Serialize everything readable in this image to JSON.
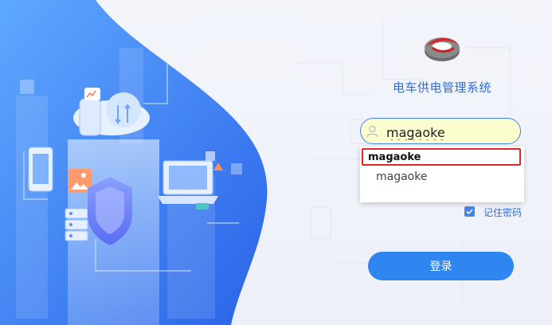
{
  "app": {
    "title": "电车供电管理系统",
    "logo_icon": "train-logo-icon"
  },
  "login_form": {
    "username_value": "magaoke",
    "username_icon": "user-icon",
    "autocomplete": {
      "highlighted": "magaoke",
      "suggestions": [
        "magaoke"
      ]
    },
    "remember_label": "记住密码",
    "remember_checked": true,
    "login_label": "登录"
  },
  "colors": {
    "accent": "#2f86f0",
    "highlight_border": "#e0262b",
    "autofill_bg": "#fcfdcf"
  }
}
